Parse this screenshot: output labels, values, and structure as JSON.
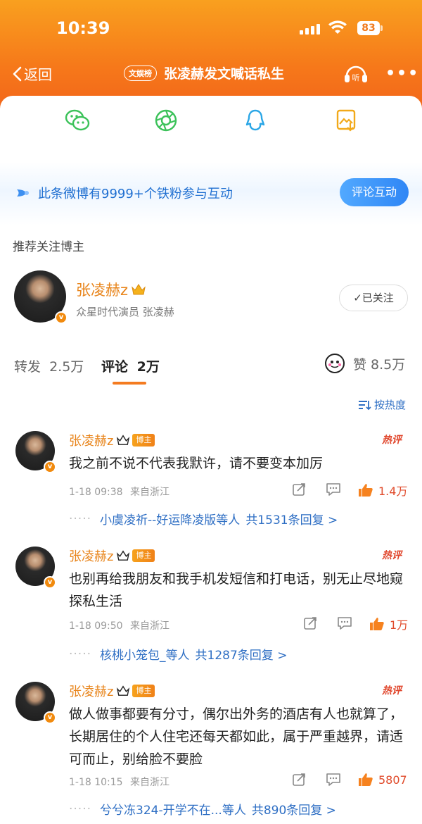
{
  "status_bar": {
    "time": "10:39",
    "battery": "83"
  },
  "nav": {
    "back_label": "返回",
    "tag": "文娱榜",
    "title": "张凌赫发文喊话私生",
    "listen_label": "听",
    "more_label": "•••"
  },
  "share_icons": [
    "wechat-icon",
    "moments-icon",
    "qq-icon",
    "save-image-icon"
  ],
  "fans_banner": {
    "text": "此条微博有9999+个铁粉参与互动",
    "button": "评论互动"
  },
  "recommend": {
    "section_title": "推荐关注博主",
    "blogger": {
      "name": "张凌赫z",
      "desc": "众星时代演员 张凌赫",
      "follow_label": "✓已关注"
    }
  },
  "stats": {
    "repost_label": "转发",
    "repost_count": "2.5万",
    "comment_label": "评论",
    "comment_count": "2万",
    "like_label": "赞",
    "like_count": "8.5万"
  },
  "sort_label": "按热度",
  "comments": [
    {
      "name": "张凌赫z",
      "tag": "博主",
      "hot": "热评",
      "text": "我之前不说不代表我默许，请不要变本加厉",
      "time": "1-18 09:38",
      "location": "来自浙江",
      "likes": "1.4万",
      "reply_users": "小虞凌祈--好运降凌版等人",
      "reply_count": "共1531条回复 >"
    },
    {
      "name": "张凌赫z",
      "tag": "博主",
      "hot": "热评",
      "text": "也别再给我朋友和我手机发短信和打电话，别无止尽地窥探私生活",
      "time": "1-18 09:50",
      "location": "来自浙江",
      "likes": "1万",
      "reply_users": "核桃小笼包_等人",
      "reply_count": "共1287条回复 >"
    },
    {
      "name": "张凌赫z",
      "tag": "博主",
      "hot": "热评",
      "text": "做人做事都要有分寸，偶尔出外务的酒店有人也就算了，长期居住的个人住宅还每天都如此，属于严重越界，请适可而止，别给脸不要脸",
      "time": "1-18 10:15",
      "location": "来自浙江",
      "likes": "5807",
      "reply_users": "兮兮冻324-开学不在...等人",
      "reply_count": "共890条回复 >"
    }
  ]
}
